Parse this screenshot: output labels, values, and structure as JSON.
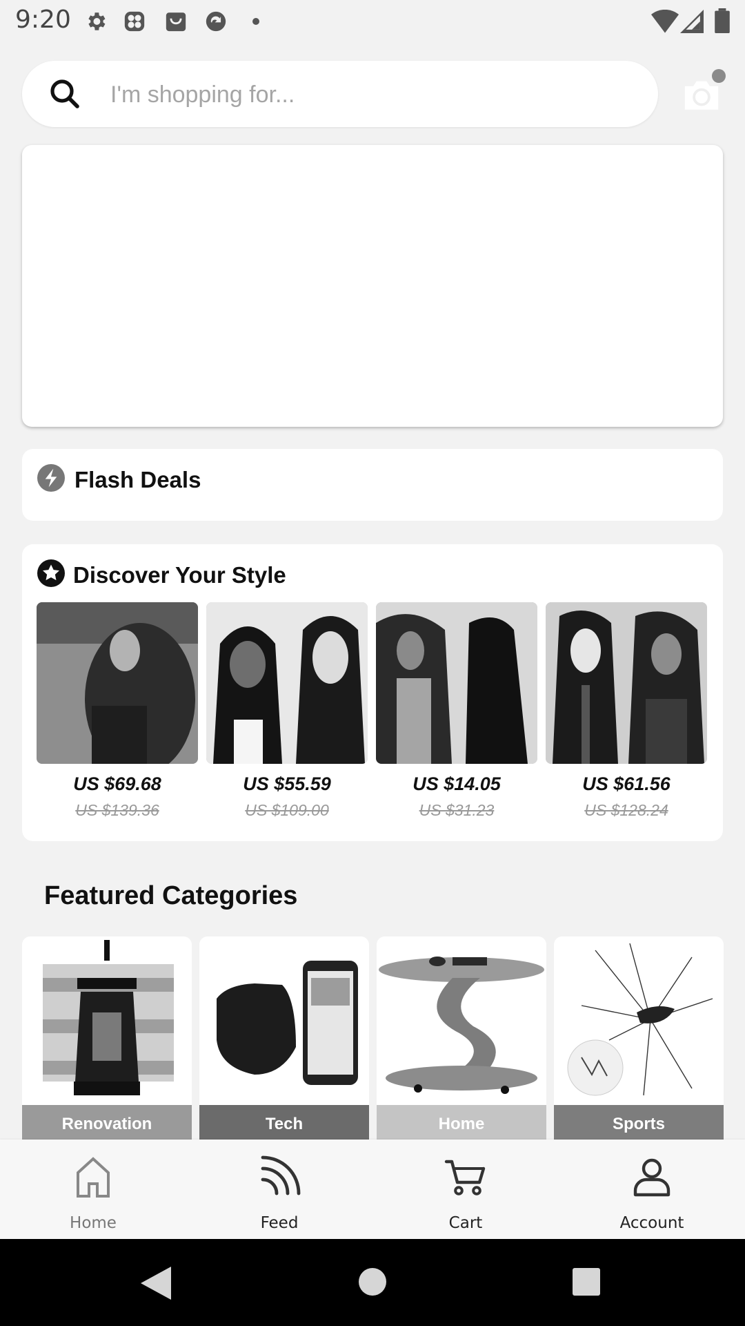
{
  "status_bar": {
    "time": "9:20",
    "icons": [
      "gear-icon",
      "fan-icon",
      "shopping-bag-icon",
      "sync-app-icon",
      "dot-icon"
    ],
    "right_icons": [
      "wifi-icon",
      "signal-icon",
      "battery-icon"
    ]
  },
  "search": {
    "placeholder": "I'm shopping for...",
    "camera_icon": "camera-icon"
  },
  "flash_deals": {
    "title": "Flash Deals"
  },
  "discover": {
    "title": "Discover Your Style",
    "products": [
      {
        "price": "US $69.68",
        "original_price": "US $139.36"
      },
      {
        "price": "US $55.59",
        "original_price": "US $109.00"
      },
      {
        "price": "US $14.05",
        "original_price": "US $31.23"
      },
      {
        "price": "US $61.56",
        "original_price": "US $128.24"
      }
    ]
  },
  "featured": {
    "title": "Featured Categories",
    "categories": [
      {
        "label": "Renovation",
        "color": "#9a9a9a"
      },
      {
        "label": "Tech",
        "color": "#6b6b6b"
      },
      {
        "label": "Home",
        "color": "#c4c4c4"
      },
      {
        "label": "Sports",
        "color": "#7d7d7d"
      }
    ]
  },
  "bottom_nav": {
    "items": [
      {
        "label": "Home",
        "icon": "home-icon"
      },
      {
        "label": "Feed",
        "icon": "feed-icon"
      },
      {
        "label": "Cart",
        "icon": "cart-icon"
      },
      {
        "label": "Account",
        "icon": "account-icon"
      }
    ]
  }
}
